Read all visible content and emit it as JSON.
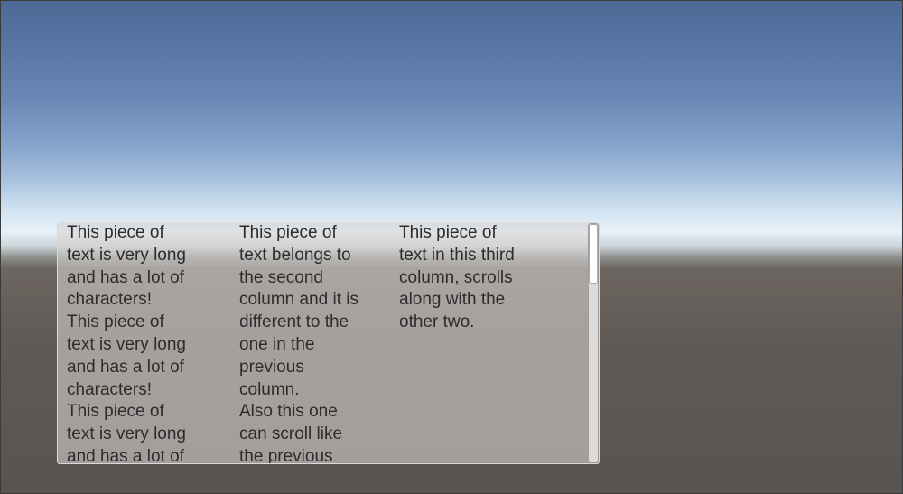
{
  "panel": {
    "columns": [
      {
        "text": "This piece of\ntext is very long\nand has a lot of\ncharacters!\nThis piece of\ntext is very long\nand has a lot of\ncharacters!\nThis piece of\ntext is very long\nand has a lot of"
      },
      {
        "text": "This piece of\ntext belongs to\nthe second\ncolumn and it is\ndifferent to the\none in the\nprevious\ncolumn.\nAlso this one\ncan scroll like\nthe previous"
      },
      {
        "text": "This piece of\ntext in this third\ncolumn, scrolls\nalong with the\nother two."
      }
    ],
    "scrollbar": {
      "orientation": "vertical",
      "scroll_position_fraction": 0,
      "visible_fraction": 0.25
    }
  },
  "colors": {
    "sky_top": "#4d6a97",
    "horizon": "#e7f1f8",
    "ground": "#5a5450",
    "panel_text": "#2c2c2c"
  }
}
